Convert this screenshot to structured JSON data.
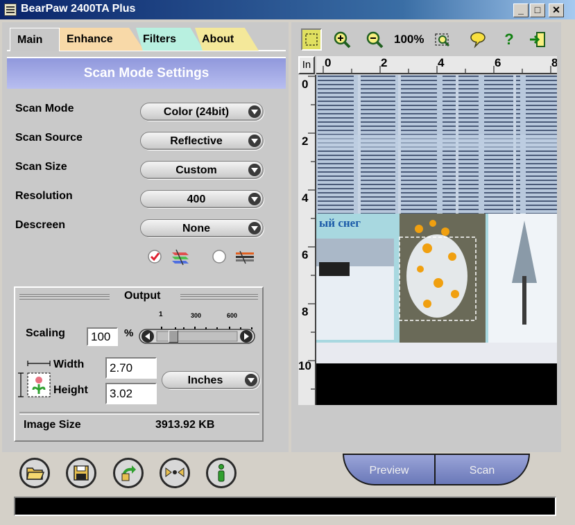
{
  "window": {
    "title": "BearPaw 2400TA Plus",
    "minimize": "_",
    "maximize": "□",
    "close": "✕"
  },
  "tabs": [
    {
      "label": "Main",
      "color": "#c8c8c8"
    },
    {
      "label": "Enhance",
      "color": "#f8d9a8"
    },
    {
      "label": "Filters",
      "color": "#b8f0e0"
    },
    {
      "label": "About",
      "color": "#f4e89a"
    }
  ],
  "section_title": "Scan Mode Settings",
  "settings": [
    {
      "label": "Scan Mode",
      "value": "Color (24bit)"
    },
    {
      "label": "Scan Source",
      "value": "Reflective"
    },
    {
      "label": "Scan Size",
      "value": "Custom"
    },
    {
      "label": "Resolution",
      "value": "400"
    },
    {
      "label": "Descreen",
      "value": "None"
    }
  ],
  "output": {
    "title": "Output",
    "scaling_label": "Scaling",
    "scaling_value": "100",
    "percent": "%",
    "slider_ticks": [
      "1",
      "300",
      "600"
    ],
    "slider_fraction": 0.0,
    "width_label": "Width",
    "width_value": "2.70",
    "height_label": "Height",
    "height_value": "3.02",
    "unit": "Inches",
    "image_size_label": "Image Size",
    "image_size_value": "3913.92 KB"
  },
  "toolbar": {
    "zoom": "100%"
  },
  "ruler": {
    "unit": "In",
    "top": [
      "0",
      "2",
      "4",
      "6",
      "8"
    ],
    "left": [
      "0",
      "2",
      "4",
      "6",
      "8",
      "10"
    ]
  },
  "preview": {
    "caption": "ый снег"
  },
  "buttons": {
    "preview": "Preview",
    "scan": "Scan"
  }
}
